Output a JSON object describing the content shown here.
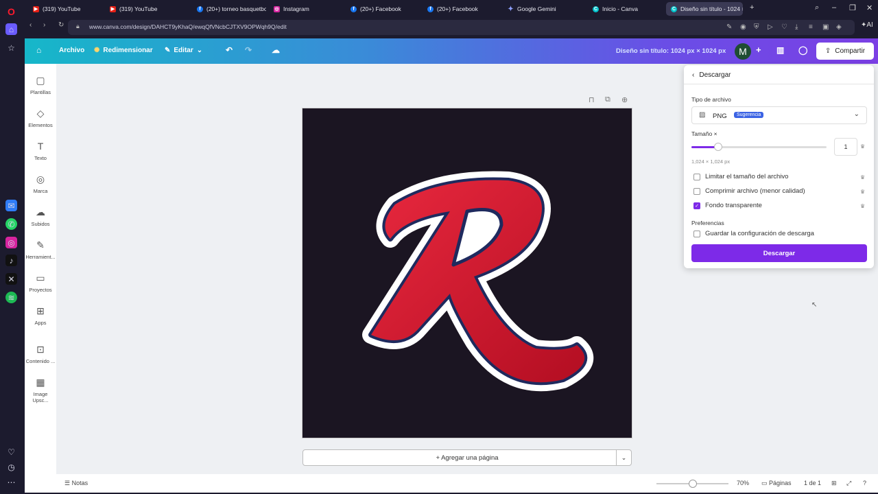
{
  "browser": {
    "tabs": [
      {
        "label": "(319) YouTube",
        "fav_color": "#e62117"
      },
      {
        "label": "(319) YouTube",
        "fav_color": "#e62117"
      },
      {
        "label": "(20+) torneo basquetbol",
        "fav_color": "#1877f2"
      },
      {
        "label": "Instagram",
        "fav_color": "#d6249f"
      },
      {
        "label": "(20+) Facebook",
        "fav_color": "#1877f2"
      },
      {
        "label": "(20+) Facebook",
        "fav_color": "#1877f2"
      },
      {
        "label": "Google Gemini",
        "fav_color": "#7d8cff"
      },
      {
        "label": "Inicio - Canva",
        "fav_color": "#00c4cc"
      },
      {
        "label": "Diseño sin título - 1024 ×",
        "fav_color": "#00c4cc"
      }
    ],
    "url": "www.canva.com/design/DAHCT9yKhaQ/ewqQfVNcbCJTXV9OPWqh9Q/edit"
  },
  "header": {
    "archivo": "Archivo",
    "redimensionar": "Redimensionar",
    "editar": "Editar",
    "design_title": "Diseño sin título: 1024 px × 1024 px",
    "avatar_letter": "M",
    "share": "Compartir"
  },
  "rail": {
    "items": [
      {
        "label": "Plantillas"
      },
      {
        "label": "Elementos"
      },
      {
        "label": "Texto"
      },
      {
        "label": "Marca"
      },
      {
        "label": "Subidos"
      },
      {
        "label": "Herramient..."
      },
      {
        "label": "Proyectos"
      },
      {
        "label": "Apps"
      },
      {
        "label": "Contenido ..."
      },
      {
        "label": "Image Upsc..."
      }
    ]
  },
  "canvas": {
    "add_page": "+ Agregar una página",
    "bg_color": "#1b1522",
    "logo_letter": "R"
  },
  "bottom": {
    "notas": "Notas",
    "zoom_pct": "70%",
    "zoom_fraction": 0.5,
    "paginas": "Páginas",
    "page_count": "1 de 1"
  },
  "download": {
    "back_label": "Descargar",
    "file_type_label": "Tipo de archivo",
    "file_type_value": "PNG",
    "suggestion_badge": "Sugerencia",
    "size_label": "Tamaño ×",
    "size_value": "1",
    "size_fraction": 0.2,
    "dimensions": "1,024 × 1,024 px",
    "limit_size": "Limitar el tamaño del archivo",
    "compress": "Comprimir archivo (menor calidad)",
    "transparent": "Fondo transparente",
    "preferences_label": "Preferencias",
    "save_config": "Guardar la configuración de descarga",
    "download_button": "Descargar",
    "accent": "#7d2ae8"
  }
}
